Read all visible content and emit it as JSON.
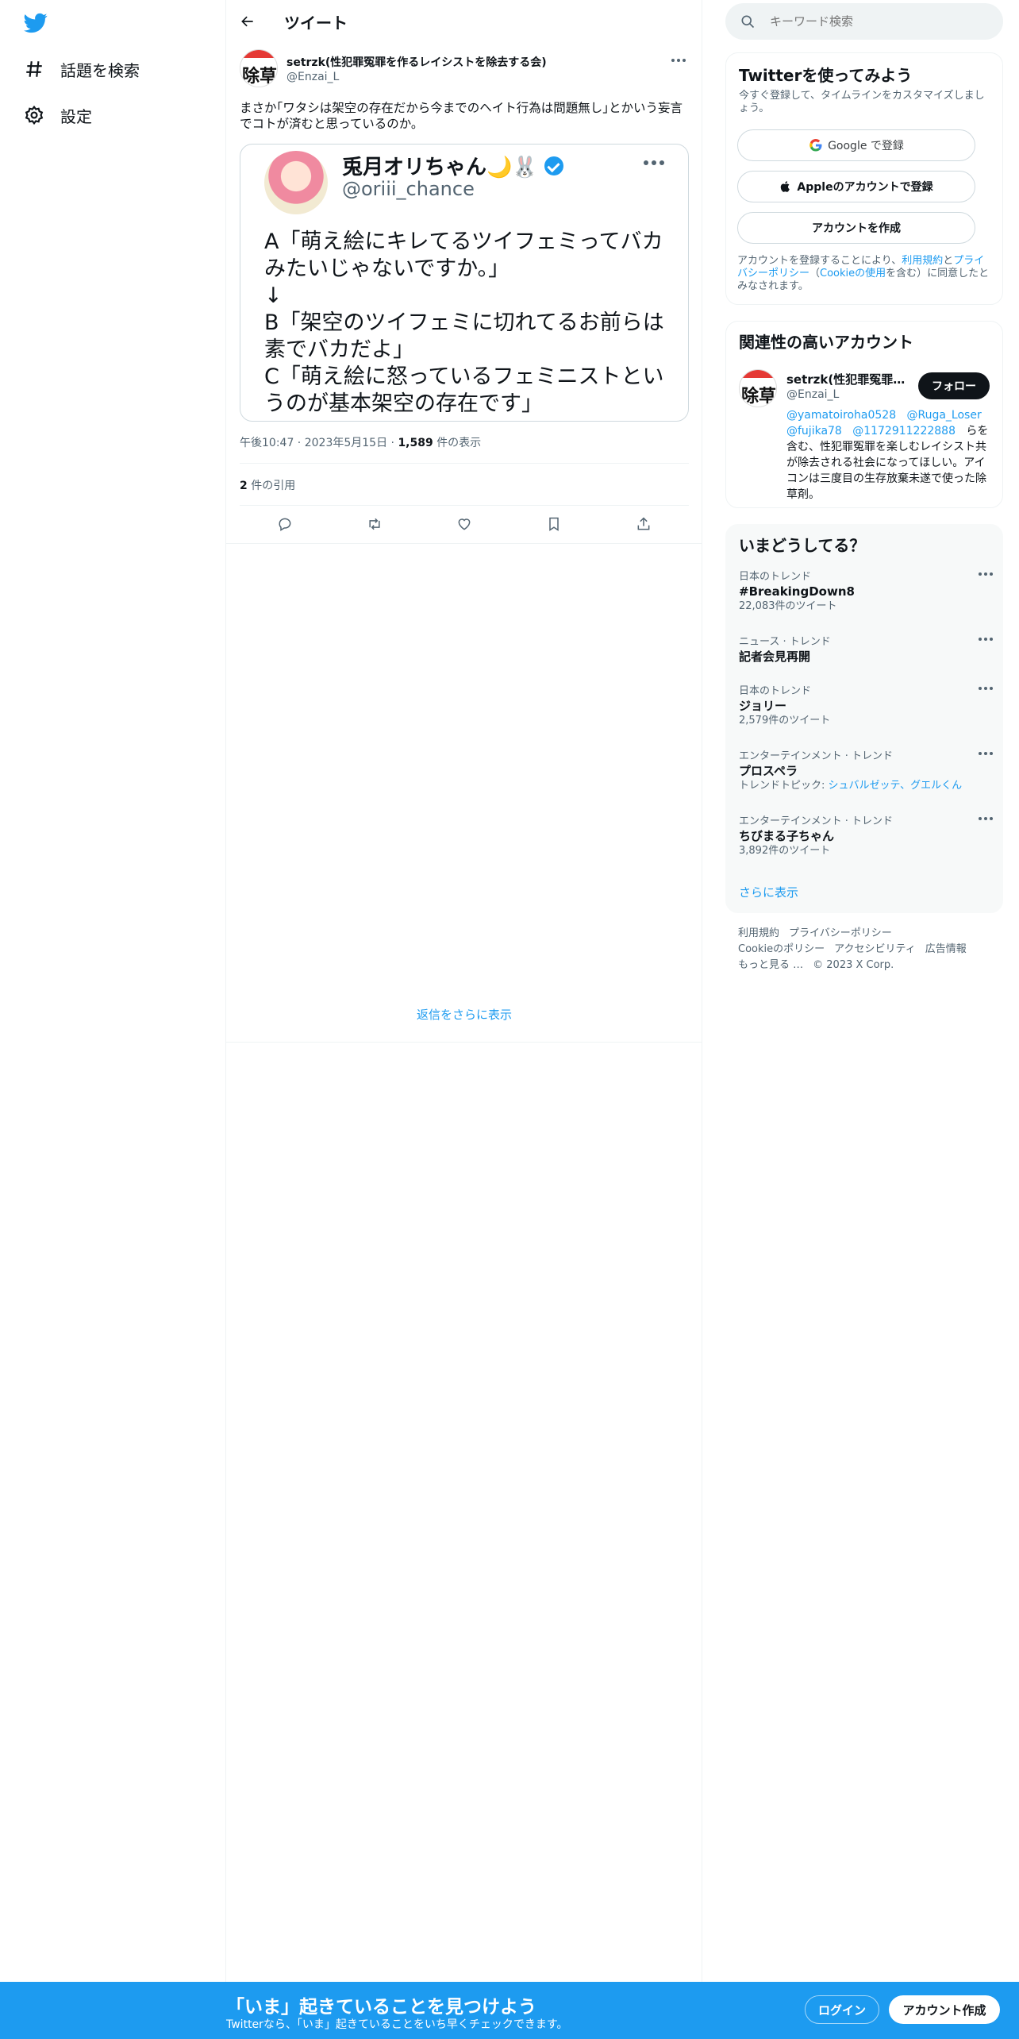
{
  "nav": {
    "explore_label": "話題を検索",
    "settings_label": "設定"
  },
  "header": {
    "title": "ツイート"
  },
  "tweet": {
    "author_name": "setrzk(性犯罪冤罪を作るレイシストを除去する会)",
    "author_handle": "@Enzai_L",
    "avatar_text": "除草",
    "text": "まさか｢ワタシは架空の存在だから今までのヘイト行為は問題無し｣とかいう妄言でコトが済むと思っているのか。",
    "image": {
      "name": "兎月オリちゃん🌙🐰",
      "handle": "@oriii_chance",
      "body": "A「萌え絵にキレてるツイフェミってバカみたいじゃないですか。」\n↓\nB「架空のツイフェミに切れてるお前らは素でバカだよ」\nC「萌え絵に怒っているフェミニストというのが基本架空の存在です」"
    },
    "time": "午後10:47",
    "date": "2023年5月15日",
    "views_count": "1,589",
    "views_label": "件の表示",
    "quotes_count": "2",
    "quotes_label": "件の引用",
    "show_more_replies": "返信をさらに表示"
  },
  "search": {
    "placeholder": "キーワード検索"
  },
  "signup_card": {
    "title": "Twitterを使ってみよう",
    "subtitle": "今すぐ登録して、タイムラインをカスタマイズしましょう。",
    "google_label": "Google で登録",
    "apple_label": "Appleのアカウントで登録",
    "create_label": "アカウントを作成",
    "legal_prefix": "アカウントを登録することにより、",
    "terms_link": "利用規約",
    "legal_and": "と",
    "privacy_link": "プライバシーポリシー",
    "legal_paren_open": "（",
    "cookie_link": "Cookieの使用",
    "legal_suffix": "を含む）に同意したとみなされます。"
  },
  "relevant": {
    "title": "関連性の高いアカウント",
    "name": "setrzk(性犯罪冤罪を作るレイシストを除去する会)",
    "handle": "@Enzai_L",
    "follow_label": "フォロー",
    "bio_mentions": [
      "@yamatoiroha0528",
      "@Ruga_Loser",
      "@fujika78",
      "@1172911222888"
    ],
    "bio_text": "らを含む、性犯罪冤罪を楽しむレイシスト共が除去される社会になってほしい。アイコンは三度目の生存放棄未遂で使った除草剤。"
  },
  "trends": {
    "title": "いまどうしてる？",
    "items": [
      {
        "category": "日本のトレンド",
        "name": "#BreakingDown8",
        "count": "22,083件のツイート"
      },
      {
        "category": "ニュース · トレンド",
        "name": "記者会見再開",
        "count": ""
      },
      {
        "category": "日本のトレンド",
        "name": "ジョリー",
        "count": "2,579件のツイート"
      },
      {
        "category": "エンターテインメント · トレンド",
        "name": "プロスペラ",
        "count": "",
        "topic_prefix": "トレンドトピック: ",
        "topic_links": "シュバルゼッテ、グエルくん"
      },
      {
        "category": "エンターテインメント · トレンド",
        "name": "ちびまる子ちゃん",
        "count": "3,892件のツイート"
      }
    ],
    "show_more": "さらに表示"
  },
  "footer": {
    "terms": "利用規約",
    "privacy": "プライバシーポリシー",
    "cookies": "Cookieのポリシー",
    "accessibility": "アクセシビリティ",
    "ads": "広告情報",
    "more": "もっと見る …",
    "copyright": "© 2023 X Corp."
  },
  "banner": {
    "title": "「いま」起きていることを見つけよう",
    "subtitle": "Twitterなら、「いま」起きていることをいち早くチェックできます。",
    "login_label": "ログイン",
    "signup_label": "アカウント作成"
  },
  "colors": {
    "brand": "#1d9bf0",
    "text": "#0f1419",
    "muted": "#536471"
  }
}
